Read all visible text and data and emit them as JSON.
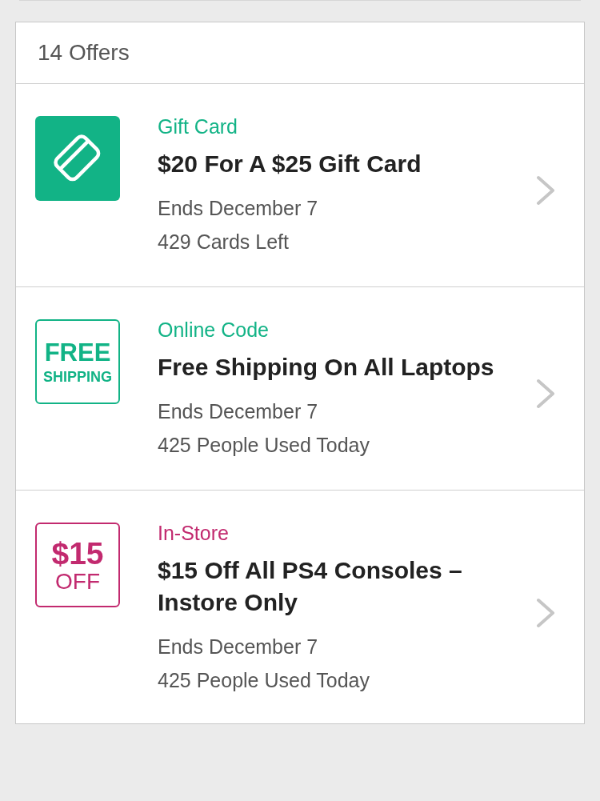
{
  "header": {
    "title": "14 Offers"
  },
  "offers": [
    {
      "kind": "gift_card",
      "color": "#12b386",
      "category": "Gift Card",
      "title": "$20 For A $25 Gift Card",
      "ends": "Ends December 7",
      "usage": "429 Cards Left"
    },
    {
      "kind": "online_code",
      "color": "#12b386",
      "badge_lines": [
        "FREE",
        "SHIPPING"
      ],
      "category": "Online Code",
      "title": "Free Shipping On All Laptops",
      "ends": "Ends December 7",
      "usage": "425 People Used Today"
    },
    {
      "kind": "in_store",
      "color": "#c22a6f",
      "badge_lines": [
        "$15",
        "OFF"
      ],
      "category": "In-Store",
      "title": "$15 Off All PS4 Consoles – Instore Only",
      "ends": "Ends December 7",
      "usage": "425 People Used Today"
    }
  ]
}
